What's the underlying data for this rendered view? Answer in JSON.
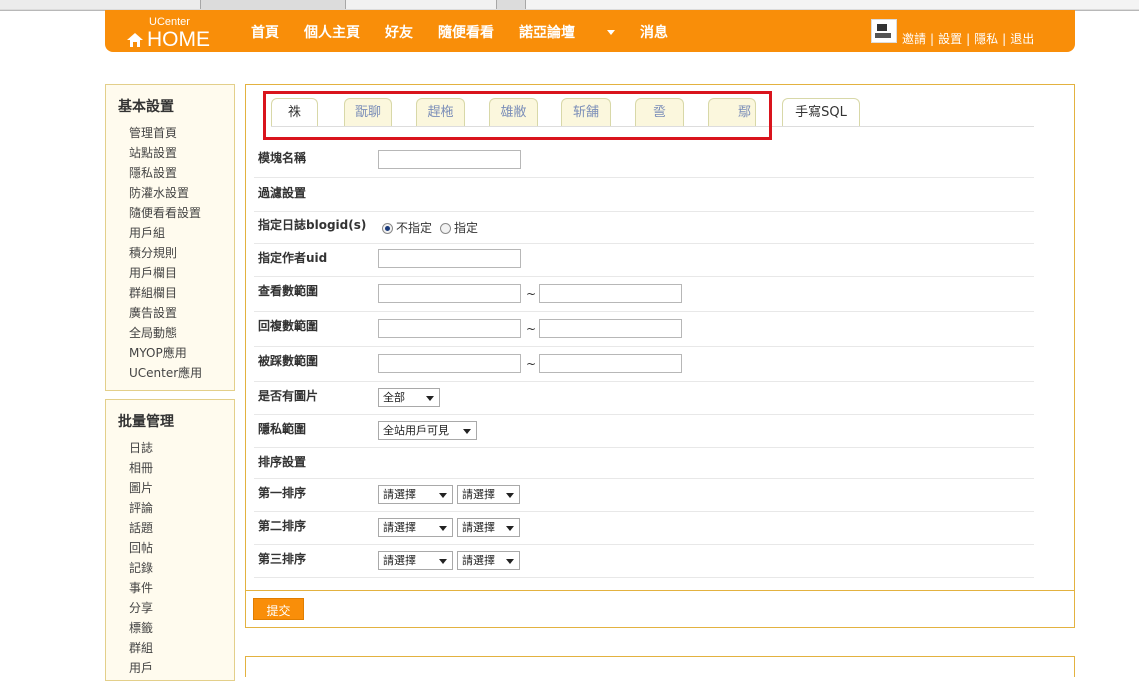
{
  "header": {
    "logo_small": "UCenter",
    "logo_big": "HOME",
    "nav": [
      "首頁",
      "個人主頁",
      "好友",
      "隨便看看",
      "諾亞論壇",
      "消息"
    ],
    "user_links": [
      "邀請",
      "設置",
      "隱私",
      "退出"
    ],
    "separator": "|"
  },
  "sidebar": {
    "group1": {
      "title": "基本設置",
      "items": [
        "管理首頁",
        "站點設置",
        "隱私設置",
        "防灌水設置",
        "隨便看看設置",
        "用戶組",
        "積分規則",
        "用戶欄目",
        "群組欄目",
        "廣告設置",
        "全局動態",
        "MYOP應用",
        "UCenter應用"
      ]
    },
    "group2": {
      "title": "批量管理",
      "items": [
        "日誌",
        "相冊",
        "圖片",
        "評論",
        "話題",
        "回帖",
        "記錄",
        "事件",
        "分享",
        "標籤",
        "群組",
        "用戶"
      ]
    }
  },
  "tabs": [
    "祩",
    "翫聊",
    "趕柂",
    "雄敝",
    "斩舗",
    "巹",
    "鄢",
    "手寫SQL"
  ],
  "form": {
    "module_name_label": "模塊名稱",
    "filter_label": "過濾設置",
    "blogid_label": "指定日誌blogid(s)",
    "blogid_options": [
      "不指定",
      "指定"
    ],
    "uid_label": "指定作者uid",
    "view_range_label": "查看數範圍",
    "reply_range_label": "回複數範圍",
    "trace_range_label": "被踩數範圍",
    "range_sep": "~",
    "has_pic_label": "是否有圖片",
    "has_pic_value": "全部",
    "privacy_label": "隱私範圍",
    "privacy_value": "全站用戶可見",
    "order_label": "排序設置",
    "order1_label": "第一排序",
    "order2_label": "第二排序",
    "order3_label": "第三排序",
    "select_placeholder": "請選擇"
  },
  "submit_label": "提交",
  "colors": {
    "brand": "#f98e09",
    "highlight_box": "#d9141d"
  }
}
